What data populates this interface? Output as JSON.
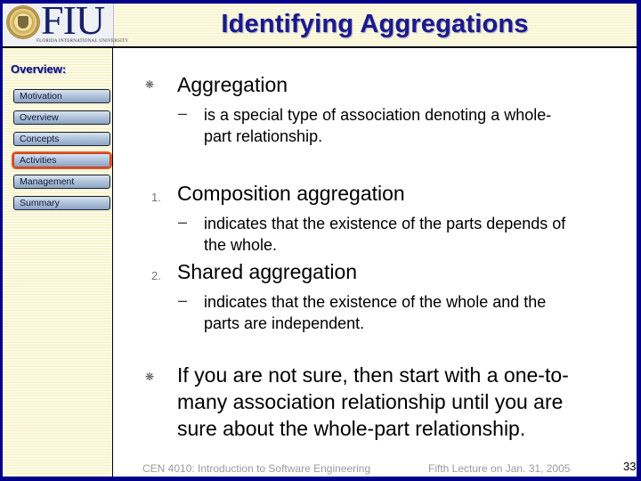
{
  "header": {
    "logo_text": "FIU",
    "logo_subtext": "FLORIDA INTERNATIONAL UNIVERSITY",
    "title": "Identifying Aggregations"
  },
  "sidebar": {
    "heading": "Overview:",
    "items": [
      {
        "label": "Motivation",
        "active": false
      },
      {
        "label": "Overview",
        "active": false
      },
      {
        "label": "Concepts",
        "active": false
      },
      {
        "label": "Activities",
        "active": true
      },
      {
        "label": "Management",
        "active": false
      },
      {
        "label": "Summary",
        "active": false
      }
    ]
  },
  "content": {
    "bullet_glyph": "❋",
    "items": [
      {
        "marker": "❋",
        "text": "Aggregation",
        "sub": [
          "– ",
          "is a special type of association denoting a whole-",
          "part relationship."
        ]
      },
      {
        "marker": "1.",
        "text": "Composition aggregation",
        "sub": [
          "– ",
          "indicates that the existence of the parts depends of",
          "the whole."
        ]
      },
      {
        "marker": "2.",
        "text": "Shared aggregation",
        "sub": [
          "– ",
          "indicates that the existence of the whole and the",
          "parts are independent."
        ]
      },
      {
        "marker": "❋",
        "lines": [
          "If you are not sure, then start with a one-to-",
          "many association relationship until you are",
          "sure about the whole-part relationship."
        ]
      }
    ]
  },
  "footer": {
    "course": "CEN 4010: Introduction to Software Engineering",
    "lecture": "Fifth Lecture on Jan. 31, 2005",
    "page_number": "33"
  },
  "colors": {
    "frame": "#00008b",
    "title": "#1a1a8c",
    "active_outline": "#e0562a",
    "stripe_bg": "#fbf8dc"
  }
}
